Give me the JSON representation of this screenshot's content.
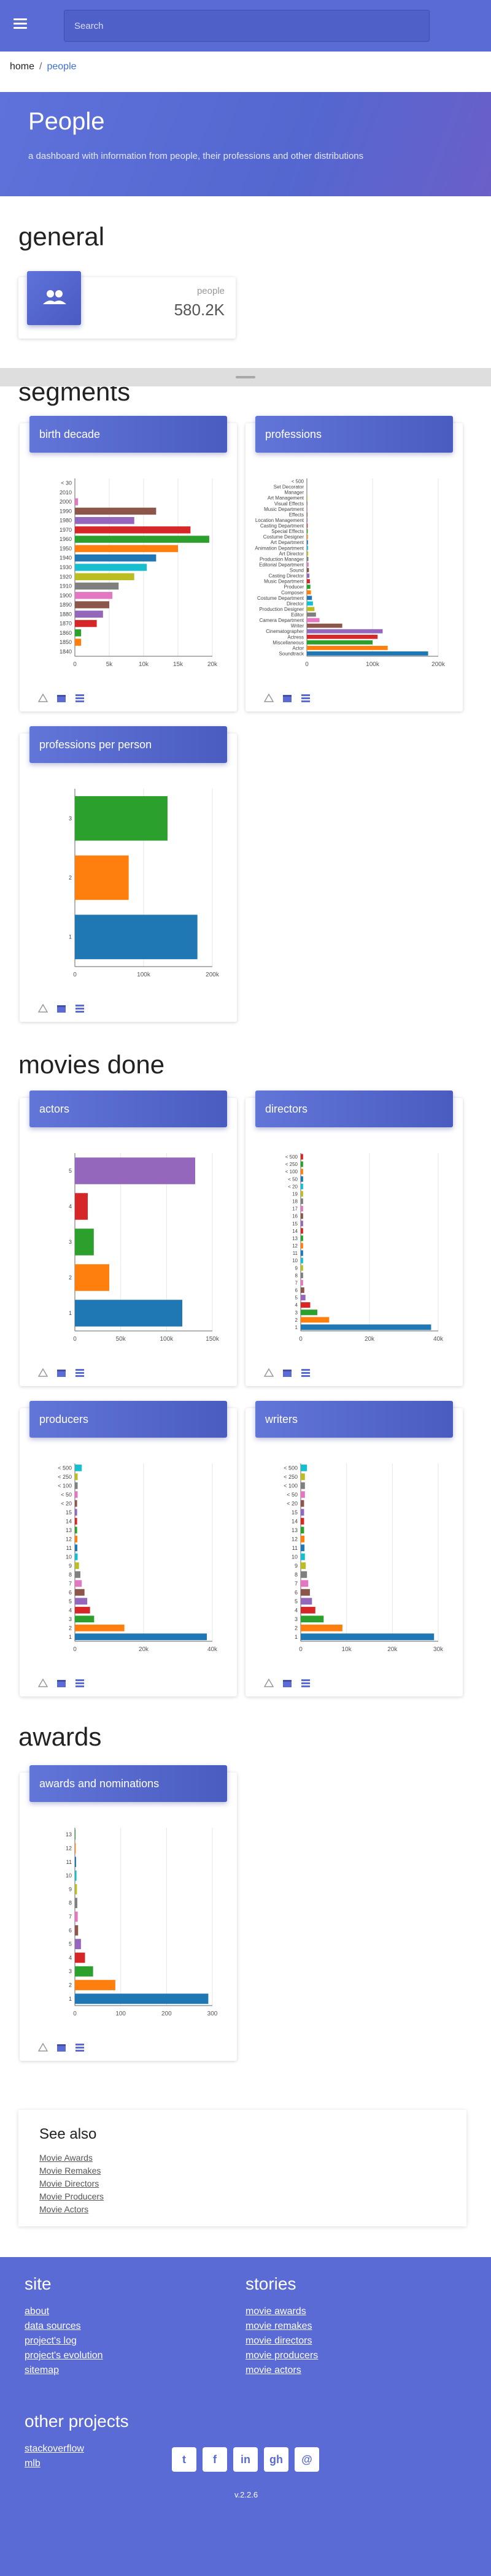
{
  "search": {
    "placeholder": "Search"
  },
  "breadcrumb": {
    "home": "home",
    "sep": "/",
    "current": "people"
  },
  "hero": {
    "title": "People",
    "subtitle": "a dashboard with information from people, their professions and other distributions"
  },
  "sections": {
    "general": "general",
    "segments": "segments",
    "movies_done": "movies done",
    "awards": "awards"
  },
  "kpi": {
    "label": "people",
    "value": "580.2K",
    "icon": "people-icon"
  },
  "cards": {
    "birth_decade": "birth decade",
    "professions": "professions",
    "professions_per_person": "professions per person",
    "actors": "actors",
    "directors": "directors",
    "producers": "producers",
    "writers": "writers",
    "awards": "awards and nominations"
  },
  "colors": [
    "#1f77b4",
    "#ff7f0e",
    "#2ca02c",
    "#d62728",
    "#9467bd",
    "#8c564b",
    "#e377c2",
    "#7f7f7f",
    "#bcbd22",
    "#17becf"
  ],
  "see_also": {
    "title": "See also",
    "links": [
      "Movie Awards",
      "Movie Remakes",
      "Movie Directors",
      "Movie Producers",
      "Movie Actors"
    ]
  },
  "footer": {
    "site_title": "site",
    "site_links": [
      "about",
      "data sources",
      "project's log",
      "project's evolution",
      "sitemap"
    ],
    "stories_title": "stories",
    "stories_links": [
      "movie awards",
      "movie remakes",
      "movie directors",
      "movie producers",
      "movie actors"
    ],
    "other_title": "other projects",
    "other_links": [
      "stackoverflow",
      "mlb"
    ],
    "social": [
      "twitter-icon",
      "facebook-icon",
      "linkedin-icon",
      "github-icon",
      "email-icon"
    ],
    "social_glyphs": [
      "t",
      "f",
      "in",
      "gh",
      "@"
    ],
    "version": "v.2.2.6"
  },
  "chart_data": [
    {
      "id": "birth_decade",
      "type": "bar",
      "orientation": "horizontal",
      "categories": [
        "< 30",
        "2010",
        "2000",
        "1990",
        "1980",
        "1970",
        "1960",
        "1950",
        "1940",
        "1930",
        "1920",
        "1910",
        "1900",
        "1890",
        "1880",
        "1870",
        "1860",
        "1850",
        "1840"
      ],
      "values": [
        0,
        0,
        500,
        13000,
        9500,
        18500,
        21500,
        16500,
        13000,
        11500,
        9500,
        7000,
        6000,
        5500,
        4500,
        3500,
        1000,
        1000,
        0
      ],
      "xticks": [
        "0",
        "5k",
        "10k",
        "15k",
        "20k"
      ],
      "xlim": [
        0,
        22000
      ]
    },
    {
      "id": "professions",
      "type": "bar",
      "orientation": "horizontal",
      "categories": [
        "< 500",
        "Set Decorator",
        "Manager",
        "Art Management",
        "Visual Effects",
        "Music Department",
        "Effects",
        "Location Management",
        "Casting Department",
        "Special Effects",
        "Costume Designer",
        "Art Department",
        "Animation Department",
        "Art Director",
        "Production Manager",
        "Editorial Department",
        "Sound",
        "Casting Director",
        "Music Department",
        "Producer",
        "Composer",
        "Costume Department",
        "Director",
        "Production Designer",
        "Editor",
        "Camera Department",
        "Writer",
        "Cinematographer",
        "Actress",
        "Miscellaneous",
        "Actor",
        "Soundtrack"
      ],
      "values": [
        0,
        0,
        0,
        500,
        700,
        900,
        1100,
        1300,
        1500,
        1700,
        1900,
        2100,
        2300,
        2600,
        3000,
        3500,
        4000,
        5000,
        6000,
        7000,
        8000,
        10000,
        12000,
        15000,
        18000,
        25000,
        70000,
        150000,
        140000,
        130000,
        160000,
        240000
      ],
      "xticks": [
        "0",
        "100k",
        "200k"
      ],
      "xlim": [
        0,
        260000
      ]
    },
    {
      "id": "professions_per_person",
      "type": "bar",
      "orientation": "horizontal",
      "categories": [
        "3",
        "2",
        "1"
      ],
      "values": [
        155000,
        90000,
        205000
      ],
      "xticks": [
        "0",
        "100k",
        "200k"
      ],
      "xlim": [
        0,
        230000
      ]
    },
    {
      "id": "actors",
      "type": "bar",
      "orientation": "horizontal",
      "categories": [
        "5",
        "4",
        "3",
        "2",
        "1"
      ],
      "values": [
        140000,
        15000,
        22000,
        40000,
        125000
      ],
      "xticks": [
        "0",
        "50k",
        "100k",
        "150k"
      ],
      "xlim": [
        0,
        160000
      ]
    },
    {
      "id": "directors",
      "type": "bar",
      "orientation": "horizontal",
      "categories": [
        "< 500",
        "< 250",
        "< 100",
        "< 50",
        "< 20",
        "19",
        "18",
        "17",
        "16",
        "15",
        "14",
        "13",
        "12",
        "11",
        "10",
        "9",
        "8",
        "7",
        "6",
        "5",
        "4",
        "3",
        "2",
        "1"
      ],
      "values": [
        1000,
        1000,
        1000,
        1000,
        1000,
        1000,
        1000,
        1000,
        1000,
        1000,
        1000,
        1000,
        1000,
        1000,
        1000,
        1000,
        1000,
        1000,
        1500,
        2000,
        4000,
        7000,
        12000,
        55000
      ],
      "xticks": [
        "0",
        "20k",
        "40k"
      ],
      "xlim": [
        0,
        58000
      ]
    },
    {
      "id": "producers",
      "type": "bar",
      "orientation": "horizontal",
      "categories": [
        "< 500",
        "< 250",
        "< 100",
        "< 50",
        "< 20",
        "15",
        "14",
        "13",
        "12",
        "11",
        "10",
        "9",
        "8",
        "7",
        "6",
        "5",
        "4",
        "3",
        "2",
        "1"
      ],
      "values": [
        2500,
        1000,
        1000,
        1000,
        800,
        800,
        800,
        800,
        900,
        900,
        1000,
        1500,
        2000,
        2500,
        3500,
        4500,
        5500,
        7000,
        18000,
        48000
      ],
      "xticks": [
        "0",
        "20k",
        "40k"
      ],
      "xlim": [
        0,
        50000
      ]
    },
    {
      "id": "writers",
      "type": "bar",
      "orientation": "horizontal",
      "categories": [
        "< 500",
        "< 250",
        "< 100",
        "< 50",
        "< 20",
        "15",
        "14",
        "13",
        "12",
        "11",
        "10",
        "9",
        "8",
        "7",
        "6",
        "5",
        "4",
        "3",
        "2",
        "1"
      ],
      "values": [
        1500,
        1000,
        1000,
        1000,
        800,
        800,
        800,
        800,
        900,
        900,
        1000,
        1200,
        1500,
        1800,
        2200,
        2700,
        3500,
        5500,
        10000,
        32000
      ],
      "xticks": [
        "0",
        "10k",
        "20k",
        "30k"
      ],
      "xlim": [
        0,
        33000
      ]
    },
    {
      "id": "awards",
      "type": "bar",
      "orientation": "horizontal",
      "categories": [
        "13",
        "12",
        "11",
        "10",
        "9",
        "8",
        "7",
        "6",
        "5",
        "4",
        "3",
        "2",
        "1"
      ],
      "values": [
        1,
        2,
        3,
        4,
        5,
        6,
        7,
        8,
        15,
        25,
        45,
        100,
        330
      ],
      "xticks": [
        "0",
        "100",
        "200",
        "300"
      ],
      "xlim": [
        0,
        340
      ]
    }
  ]
}
